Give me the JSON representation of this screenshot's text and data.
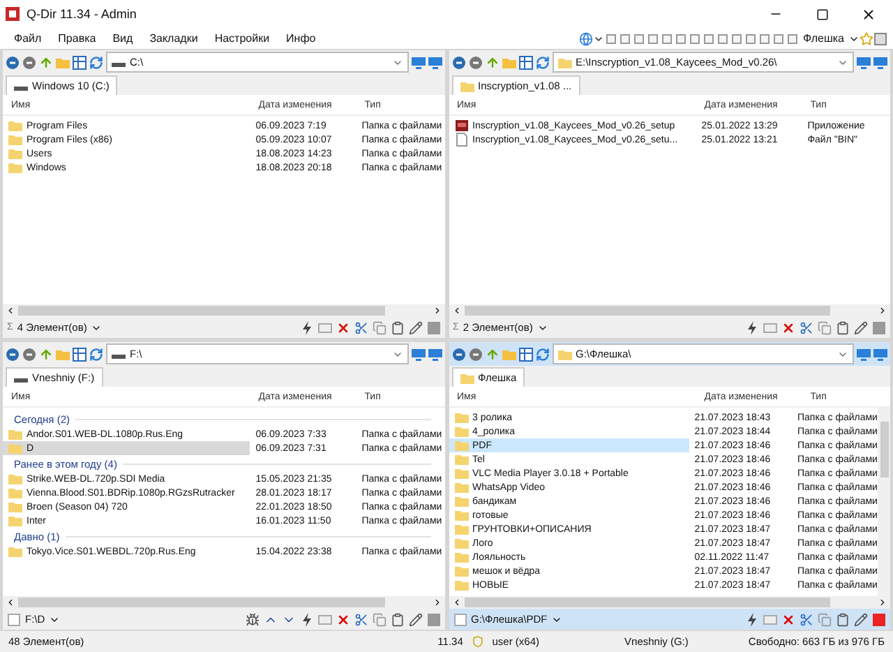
{
  "window": {
    "title": "Q-Dir 11.34 - Admin"
  },
  "menu": [
    "Файл",
    "Правка",
    "Вид",
    "Закладки",
    "Настройки",
    "Инфо"
  ],
  "drive_button": {
    "label": "Флешка"
  },
  "panes": [
    {
      "kind": "drive",
      "active": false,
      "address": "C:\\",
      "tab": "Windows 10 (C:)",
      "columns": [
        "Имя",
        "Дата изменения",
        "Тип"
      ],
      "footer": {
        "symbol": "Σ",
        "label": "4 Элемент(ов)"
      },
      "items": [
        {
          "kind": "folder",
          "name": "Program Files",
          "date": "06.09.2023 7:19",
          "type": "Папка с файлами",
          "selected": false
        },
        {
          "kind": "folder",
          "name": "Program Files (x86)",
          "date": "05.09.2023 10:07",
          "type": "Папка с файлами",
          "selected": false
        },
        {
          "kind": "folder",
          "name": "Users",
          "date": "18.08.2023 14:23",
          "type": "Папка с файлами",
          "selected": false
        },
        {
          "kind": "folder",
          "name": "Windows",
          "date": "18.08.2023 20:18",
          "type": "Папка с файлами",
          "selected": false
        }
      ]
    },
    {
      "kind": "folder",
      "active": false,
      "address": "E:\\Inscryption_v1.08_Kaycees_Mod_v0.26\\",
      "tab": "Inscryption_v1.08 ...",
      "columns": [
        "Имя",
        "Дата изменения",
        "Тип"
      ],
      "footer": {
        "symbol": "Σ",
        "label": "2 Элемент(ов)"
      },
      "items": [
        {
          "kind": "app",
          "name": "Inscryption_v1.08_Kaycees_Mod_v0.26_setup",
          "date": "25.01.2022 13:29",
          "type": "Приложение",
          "selected": false
        },
        {
          "kind": "file",
          "name": "Inscryption_v1.08_Kaycees_Mod_v0.26_setu...",
          "date": "25.01.2022 13:21",
          "type": "Файл \"BIN\"",
          "selected": false
        }
      ]
    },
    {
      "kind": "drive",
      "active": false,
      "address": "F:\\",
      "tab": "Vneshniy (F:)",
      "columns": [
        "Имя",
        "Дата изменения",
        "Тип"
      ],
      "footer": {
        "label": "F:\\D"
      },
      "items": [
        {
          "kind": "group",
          "label": "Сегодня (2)"
        },
        {
          "kind": "folder",
          "name": "Andor.S01.WEB-DL.1080p.Rus.Eng",
          "date": "06.09.2023 7:33",
          "type": "Папка с файлами",
          "selected": false
        },
        {
          "kind": "folder",
          "name": "D",
          "date": "06.09.2023 7:31",
          "type": "Папка с файлами",
          "selected": true
        },
        {
          "kind": "group",
          "label": "Ранее в этом году (4)"
        },
        {
          "kind": "folder",
          "name": "Strike.WEB-DL.720p.SDI Media",
          "date": "15.05.2023 21:35",
          "type": "Папка с файлами",
          "selected": false
        },
        {
          "kind": "folder",
          "name": "Vienna.Blood.S01.BDRip.1080p.RGzsRutracker",
          "date": "28.01.2023 18:17",
          "type": "Папка с файлами",
          "selected": false
        },
        {
          "kind": "folder",
          "name": "Broen    (Season 04) 720",
          "date": "22.01.2023 18:50",
          "type": "Папка с файлами",
          "selected": false
        },
        {
          "kind": "folder",
          "name": "Inter",
          "date": "16.01.2023 11:50",
          "type": "Папка с файлами",
          "selected": false
        },
        {
          "kind": "group",
          "label": "Давно (1)"
        },
        {
          "kind": "folder",
          "name": "Tokyo.Vice.S01.WEBDL.720p.Rus.Eng",
          "date": "15.04.2022 23:38",
          "type": "Папка с файлами",
          "selected": false
        }
      ]
    },
    {
      "kind": "folder",
      "active": true,
      "address": "G:\\Флешка\\",
      "tab": "Флешка",
      "columns": [
        "Имя",
        "Дата изменения",
        "Тип"
      ],
      "footer": {
        "label": "G:\\Флешка\\PDF"
      },
      "items": [
        {
          "kind": "folder",
          "name": "3 ролика",
          "date": "21.07.2023 18:43",
          "type": "Папка с файлами",
          "selected": false
        },
        {
          "kind": "folder",
          "name": "4_ролика",
          "date": "21.07.2023 18:44",
          "type": "Папка с файлами",
          "selected": false
        },
        {
          "kind": "folder",
          "name": "PDF",
          "date": "21.07.2023 18:46",
          "type": "Папка с файлами",
          "selected": true
        },
        {
          "kind": "folder",
          "name": "Tel",
          "date": "21.07.2023 18:46",
          "type": "Папка с файлами",
          "selected": false
        },
        {
          "kind": "folder",
          "name": "VLC Media Player 3.0.18 + Portable",
          "date": "21.07.2023 18:46",
          "type": "Папка с файлами",
          "selected": false
        },
        {
          "kind": "folder",
          "name": "WhatsApp Video",
          "date": "21.07.2023 18:46",
          "type": "Папка с файлами",
          "selected": false
        },
        {
          "kind": "folder",
          "name": "бандикам",
          "date": "21.07.2023 18:46",
          "type": "Папка с файлами",
          "selected": false
        },
        {
          "kind": "folder",
          "name": "готовые",
          "date": "21.07.2023 18:46",
          "type": "Папка с файлами",
          "selected": false
        },
        {
          "kind": "folder",
          "name": "ГРУНТОВКИ+ОПИСАНИЯ",
          "date": "21.07.2023 18:47",
          "type": "Папка с файлами",
          "selected": false
        },
        {
          "kind": "folder",
          "name": "Лого",
          "date": "21.07.2023 18:47",
          "type": "Папка с файлами",
          "selected": false
        },
        {
          "kind": "folder",
          "name": "Лояльность",
          "date": "02.11.2022 11:47",
          "type": "Папка с файлами",
          "selected": false
        },
        {
          "kind": "folder",
          "name": "мешок и вёдра",
          "date": "21.07.2023 18:47",
          "type": "Папка с файлами",
          "selected": false
        },
        {
          "kind": "folder",
          "name": "НОВЫЕ",
          "date": "21.07.2023 18:47",
          "type": "Папка с файлами",
          "selected": false
        }
      ]
    }
  ],
  "status_bar": {
    "count": "48 Элемент(ов)",
    "version": "11.34",
    "user": "user (x64)",
    "drive": "Vneshniy (G:)",
    "free": "Свободно: 663 ГБ из 976 ГБ"
  }
}
